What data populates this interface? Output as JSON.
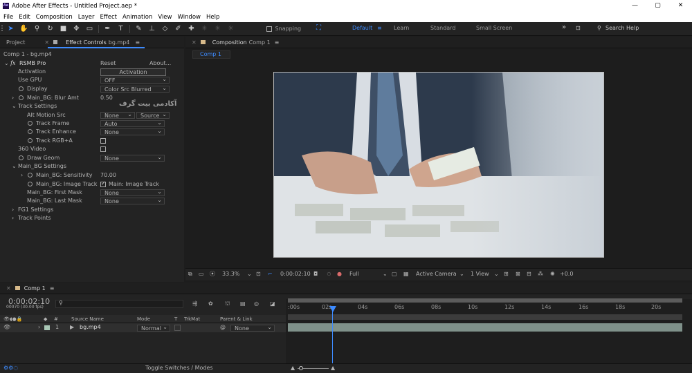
{
  "window": {
    "title": "Adobe After Effects - Untitled Project.aep *",
    "logo": "Ae",
    "minimize": "—",
    "restore": "▢",
    "close": "✕"
  },
  "menu": [
    "File",
    "Edit",
    "Composition",
    "Layer",
    "Effect",
    "Animation",
    "View",
    "Window",
    "Help"
  ],
  "toolbar": {
    "snapping": "Snapping",
    "workspaces": [
      "Default",
      "Learn",
      "Standard",
      "Small Screen"
    ],
    "more": "»",
    "search_placeholder": "Search Help"
  },
  "left_tabs": {
    "project": "Project",
    "effect_controls": "Effect Controls",
    "effect_controls_layer": "bg.mp4"
  },
  "layer_path": "Comp 1 - bg.mp4",
  "effect": {
    "fx": "fx",
    "name": "RSMB Pro",
    "reset": "Reset",
    "about": "About...",
    "activation_label": "Activation",
    "activation_button": "Activation",
    "use_gpu_label": "Use GPU",
    "use_gpu_value": "OFF",
    "display_label": "Display",
    "display_value": "Color Src Blurred",
    "blur_amt_label": "Main_BG: Blur Amt",
    "blur_amt_value": "0.50",
    "watermark": "آکادمی بیت گرف",
    "track_settings": "Track Settings",
    "alt_motion_src": "Alt Motion Src",
    "alt_motion_value": "None",
    "alt_motion_source": "Source",
    "track_frame": "Track Frame",
    "track_frame_value": "Auto",
    "track_enhance": "Track Enhance",
    "track_enhance_value": "None",
    "track_rgba": "Track RGB+A",
    "video_360": "360 Video",
    "draw_geom": "Draw Geom",
    "draw_geom_value": "None",
    "main_bg_settings": "Main_BG Settings",
    "sensitivity": "Main_BG: Sensitivity",
    "sensitivity_value": "70.00",
    "image_track": "Main_BG: Image Track",
    "image_track_value": "Main: Image Track",
    "first_mask": "Main_BG: First Mask",
    "first_mask_value": "None",
    "last_mask": "Main_BG: Last Mask",
    "last_mask_value": "None",
    "fg1_settings": "FG1 Settings",
    "track_points": "Track Points"
  },
  "comp_panel": {
    "tab": "Composition",
    "tab_comp": "Comp 1",
    "subtab": "Comp 1",
    "zoom": "33.3%",
    "timecode": "0:00:02:10",
    "resolution": "Full",
    "camera": "Active Camera",
    "view": "1 View",
    "exposure": "+0.0"
  },
  "timeline": {
    "tab": "Comp 1",
    "timecode": "0:00:02:10",
    "frames": "00070 (30.00 fps)",
    "search_placeholder": "",
    "col_num": "#",
    "col_source": "Source Name",
    "col_mode": "Mode",
    "col_t": "T",
    "col_trkmat": "TrkMat",
    "col_parent": "Parent & Link",
    "layer_num": "1",
    "layer_name": "bg.mp4",
    "layer_mode": "Normal",
    "layer_parent": "None",
    "ruler": [
      ":00s",
      "02s",
      "04s",
      "06s",
      "08s",
      "10s",
      "12s",
      "14s",
      "16s",
      "18s",
      "20s"
    ],
    "toggle": "Toggle Switches / Modes",
    "playhead_position_seconds": 2.33
  }
}
